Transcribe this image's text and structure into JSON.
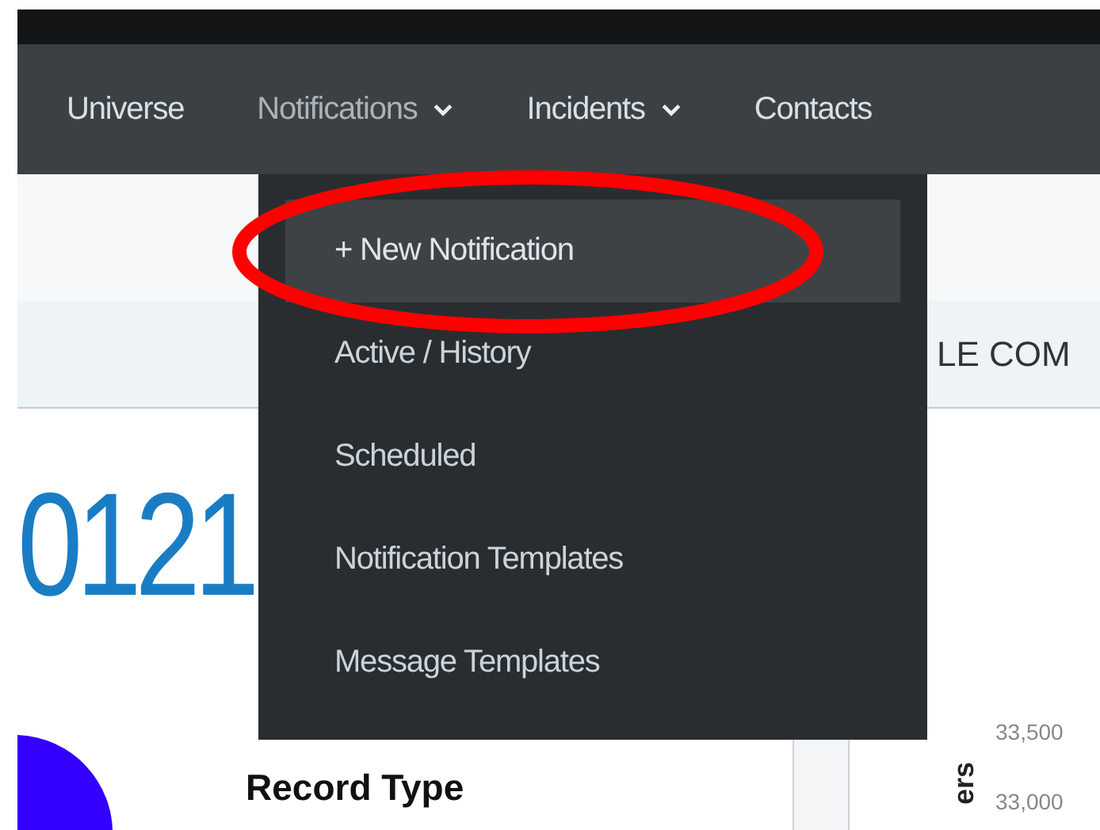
{
  "nav": {
    "items": [
      {
        "label": "Universe",
        "menu": false,
        "expanded": false
      },
      {
        "label": "Notifications",
        "menu": true,
        "expanded": true
      },
      {
        "label": "Incidents",
        "menu": true,
        "expanded": false
      },
      {
        "label": "Contacts",
        "menu": false,
        "expanded": false
      }
    ]
  },
  "dropdown": {
    "items": [
      {
        "label": "+ New Notification",
        "selected": true
      },
      {
        "label": "Active / History",
        "selected": false
      },
      {
        "label": "Scheduled",
        "selected": false
      },
      {
        "label": "Notification Templates",
        "selected": false
      },
      {
        "label": "Message Templates",
        "selected": false
      }
    ]
  },
  "subheader": {
    "text": "LE COM"
  },
  "dashboard": {
    "big_number": "0121",
    "record_type_title": "Record Type",
    "axis_title": "ers",
    "y_ticks": [
      "33,500",
      "33,000"
    ]
  }
}
